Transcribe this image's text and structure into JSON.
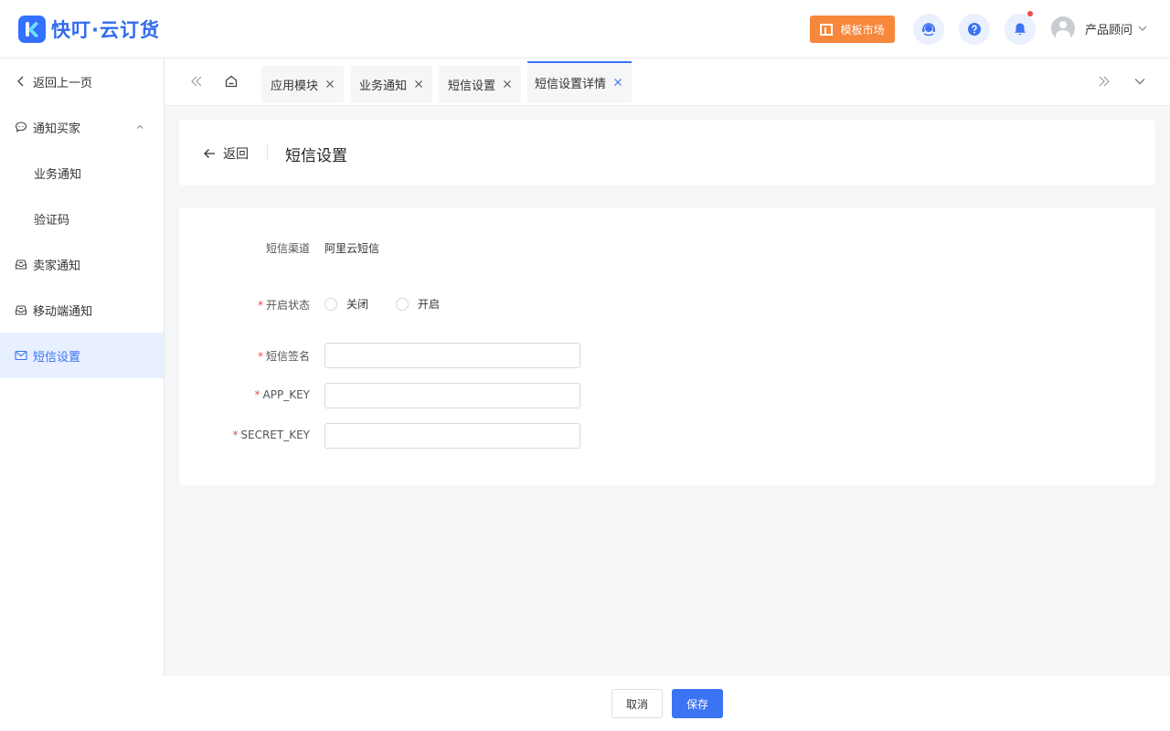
{
  "app": {
    "title": "快叮·云订货",
    "template_market": "模板市场",
    "user_name": "产品顾问"
  },
  "sidebar": {
    "back": "返回上一页",
    "group_notify_buyer": "通知买家",
    "business_notify": "业务通知",
    "verify_code": "验证码",
    "seller_notify": "卖家通知",
    "mobile_notify": "移动端通知",
    "sms_settings": "短信设置"
  },
  "tabs": [
    {
      "label": "应用模块"
    },
    {
      "label": "业务通知"
    },
    {
      "label": "短信设置"
    },
    {
      "label": "短信设置详情",
      "active": true
    }
  ],
  "page": {
    "back_label": "返回",
    "title": "短信设置"
  },
  "form": {
    "channel_label": "短信渠道",
    "channel_value": "阿里云短信",
    "status_label": "开启状态",
    "status_options": [
      "关闭",
      "开启"
    ],
    "signature_label": "短信签名",
    "signature_value": "",
    "app_key_label": "APP_KEY",
    "app_key_value": "",
    "secret_key_label": "SECRET_KEY",
    "secret_key_value": ""
  },
  "footer": {
    "cancel": "取消",
    "save": "保存"
  },
  "colors": {
    "accent": "#3b73f3",
    "template_button": "#f7873b",
    "required": "#f04a4a",
    "notification_dot": "#f04a4a"
  }
}
